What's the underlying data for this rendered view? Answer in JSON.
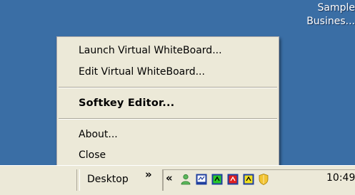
{
  "desktop": {
    "labels": [
      "Sample",
      "Busines..."
    ]
  },
  "context_menu": {
    "items": [
      {
        "label": "Launch Virtual WhiteBoard...",
        "bold": false
      },
      {
        "label": "Edit Virtual WhiteBoard...",
        "bold": false
      },
      {
        "label": "Softkey Editor...",
        "bold": true
      },
      {
        "label": "About...",
        "bold": false
      },
      {
        "label": "Close",
        "bold": false
      }
    ]
  },
  "taskbar": {
    "toolbar_label": "Desktop",
    "toolbar_chevron": "»",
    "tray_collapse": "«",
    "clock": "10:49",
    "tray_icons": [
      "messenger-user-icon",
      "whiteboard-icon",
      "softkey-green-icon",
      "softkey-red-icon",
      "softkey-yellow-icon",
      "shield-icon"
    ],
    "colors": {
      "desktop": "#3a6ea5",
      "taskbar": "#ece9d8",
      "menu": "#ece9d8"
    }
  }
}
